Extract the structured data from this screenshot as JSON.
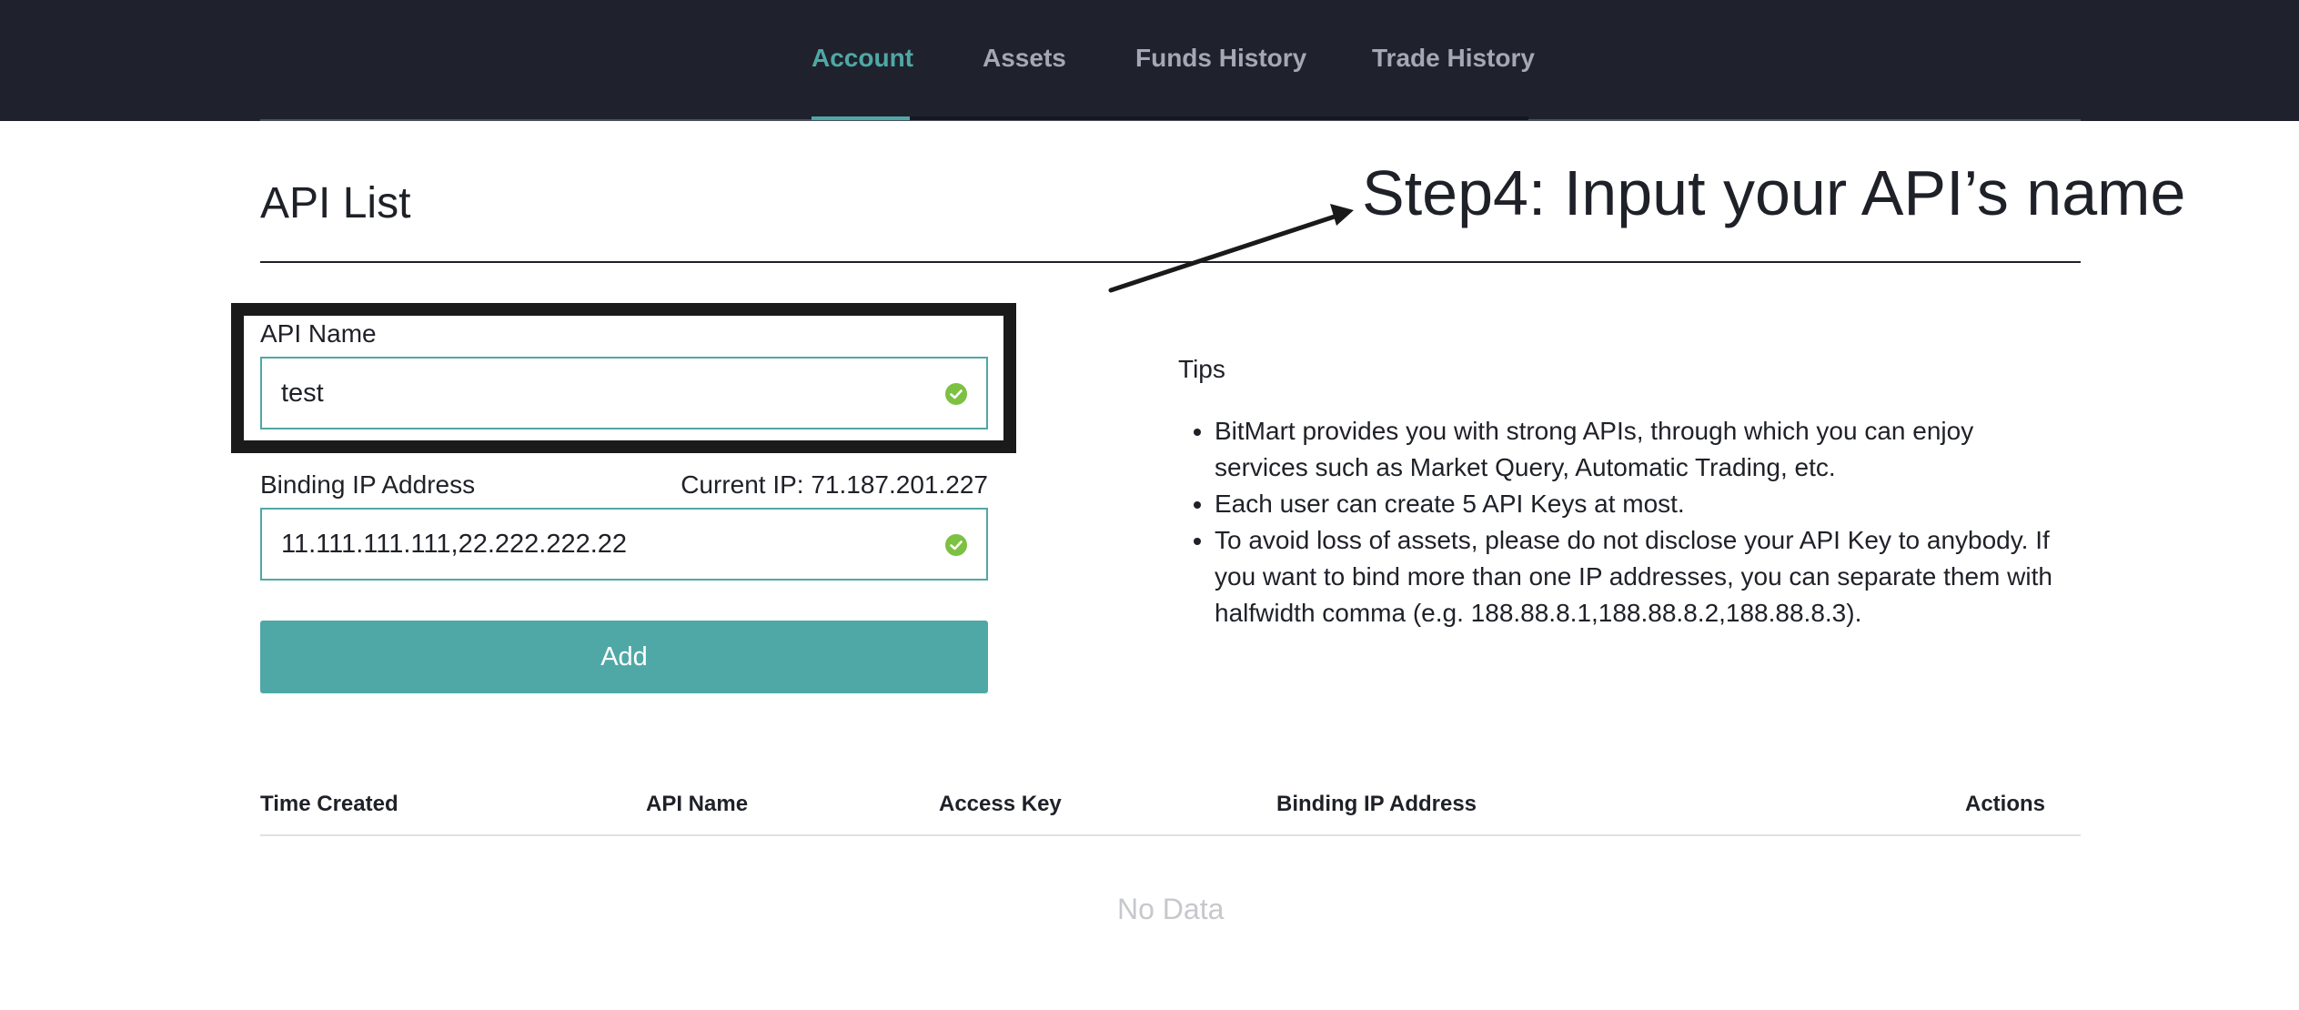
{
  "nav": {
    "tabs": [
      {
        "label": "Account",
        "active": true
      },
      {
        "label": "Assets",
        "active": false
      },
      {
        "label": "Funds History",
        "active": false
      },
      {
        "label": "Trade History",
        "active": false
      }
    ]
  },
  "page_title": "API List",
  "annotation": {
    "text": "Step4: Input your API’s name"
  },
  "form": {
    "api_name": {
      "label": "API Name",
      "value": "test",
      "status_icon": "check-circle-icon"
    },
    "binding_ip": {
      "label": "Binding IP Address",
      "current_ip": "Current IP: 71.187.201.227",
      "value": "11.111.111.111,22.222.222.22",
      "status_icon": "check-circle-icon"
    },
    "add_button_label": "Add"
  },
  "tips": {
    "title": "Tips",
    "items": [
      "BitMart provides you with strong APIs, through which you can enjoy services such as Market Query, Automatic Trading, etc.",
      "Each user can create 5 API Keys at most.",
      "To avoid loss of assets, please do not disclose your API Key to anybody. If you want to bind more than one IP addresses, you can separate them with halfwidth comma (e.g. 188.88.8.1,188.88.8.2,188.88.8.3)."
    ]
  },
  "table": {
    "columns": [
      "Time Created",
      "API Name",
      "Access Key",
      "Binding IP Address",
      "Actions"
    ],
    "empty_text": "No Data"
  },
  "colors": {
    "accent": "#4fa8a6",
    "topbar": "#1f222d",
    "success": "#7cc142"
  }
}
